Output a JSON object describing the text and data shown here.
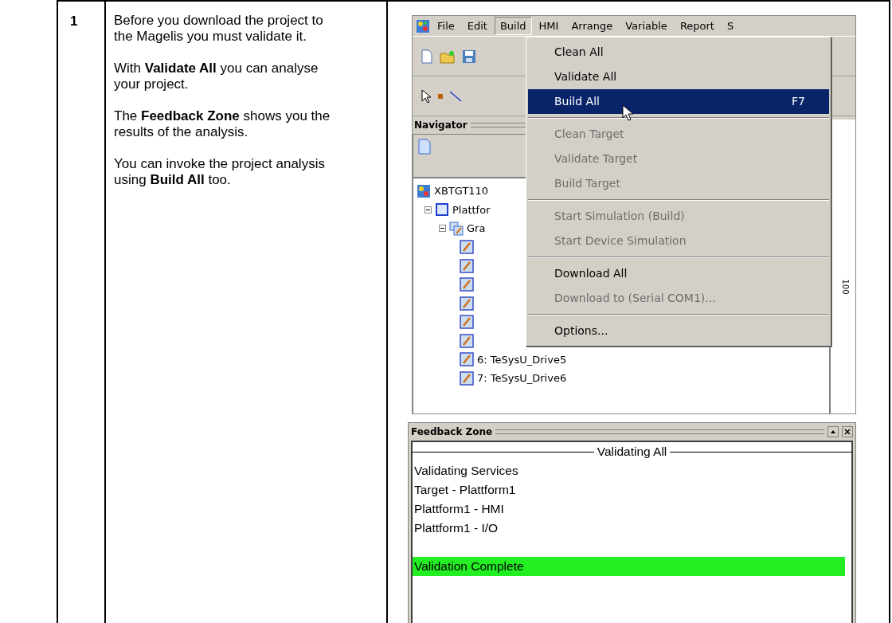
{
  "step": {
    "number": "1",
    "paragraphs": [
      "Before you download the project to the Magelis you must validate it.",
      "With **Validate All** you can analyse your project.",
      "The **Feedback Zone** shows you the results of the analysis.",
      "You can invoke the project analysis using **Build All** too."
    ]
  },
  "app_screenshot": {
    "menu_bar": [
      {
        "label": "File",
        "selected": false
      },
      {
        "label": "Edit",
        "selected": false
      },
      {
        "label": "Build",
        "selected": true
      },
      {
        "label": "HMI",
        "selected": false
      },
      {
        "label": "Arrange",
        "selected": false
      },
      {
        "label": "Variable",
        "selected": false
      },
      {
        "label": "Report",
        "selected": false
      },
      {
        "label": "S",
        "selected": false
      }
    ],
    "build_menu": [
      {
        "kind": "item",
        "label": "Clean All",
        "disabled": false,
        "selected": false
      },
      {
        "kind": "item",
        "label": "Validate All",
        "disabled": false,
        "selected": false
      },
      {
        "kind": "item",
        "label": "Build All",
        "shortcut": "F7",
        "disabled": false,
        "selected": true
      },
      {
        "kind": "separator"
      },
      {
        "kind": "item",
        "label": "Clean Target",
        "disabled": true,
        "selected": false
      },
      {
        "kind": "item",
        "label": "Validate Target",
        "disabled": true,
        "selected": false
      },
      {
        "kind": "item",
        "label": "Build Target",
        "disabled": true,
        "selected": false
      },
      {
        "kind": "separator"
      },
      {
        "kind": "item",
        "label": "Start Simulation (Build)",
        "disabled": true,
        "selected": false
      },
      {
        "kind": "item",
        "label": "Start Device Simulation",
        "disabled": true,
        "selected": false
      },
      {
        "kind": "separator"
      },
      {
        "kind": "item",
        "label": "Download All",
        "disabled": false,
        "selected": false
      },
      {
        "kind": "item",
        "label": "Download to (Serial COM1)...",
        "disabled": true,
        "selected": false
      },
      {
        "kind": "separator"
      },
      {
        "kind": "item",
        "label": "Options...",
        "disabled": false,
        "selected": false
      }
    ],
    "navigator": {
      "title": "Navigator",
      "tree": [
        {
          "label": "XBTGT110",
          "children": [
            {
              "label": "Plattfor",
              "expanded": true,
              "children": [
                {
                  "label": "Gra",
                  "expanded": true,
                  "children": [
                    {
                      "kind": "icon_only"
                    },
                    {
                      "kind": "icon_only"
                    },
                    {
                      "kind": "icon_only"
                    },
                    {
                      "kind": "icon_only"
                    },
                    {
                      "kind": "icon_only"
                    },
                    {
                      "kind": "icon_only"
                    },
                    {
                      "kind": "item",
                      "label": "6: TeSysU_Drive5"
                    },
                    {
                      "kind": "item",
                      "label": "7: TeSysU_Drive6"
                    }
                  ]
                }
              ]
            }
          ]
        }
      ]
    },
    "ruler_label": "100"
  },
  "feedback_zone": {
    "title": "Feedback Zone",
    "heading": "Validating All",
    "lines": [
      {
        "kind": "line",
        "text": "Validating Services",
        "highlighted": false
      },
      {
        "kind": "line",
        "text": "Target - Plattform1",
        "highlighted": false
      },
      {
        "kind": "line",
        "text": "Plattform1 - HMI",
        "highlighted": false
      },
      {
        "kind": "line",
        "text": "Plattform1 - I/O",
        "highlighted": false
      },
      {
        "kind": "spacer"
      },
      {
        "kind": "line",
        "text": "Validation Complete",
        "highlighted": true
      }
    ]
  }
}
